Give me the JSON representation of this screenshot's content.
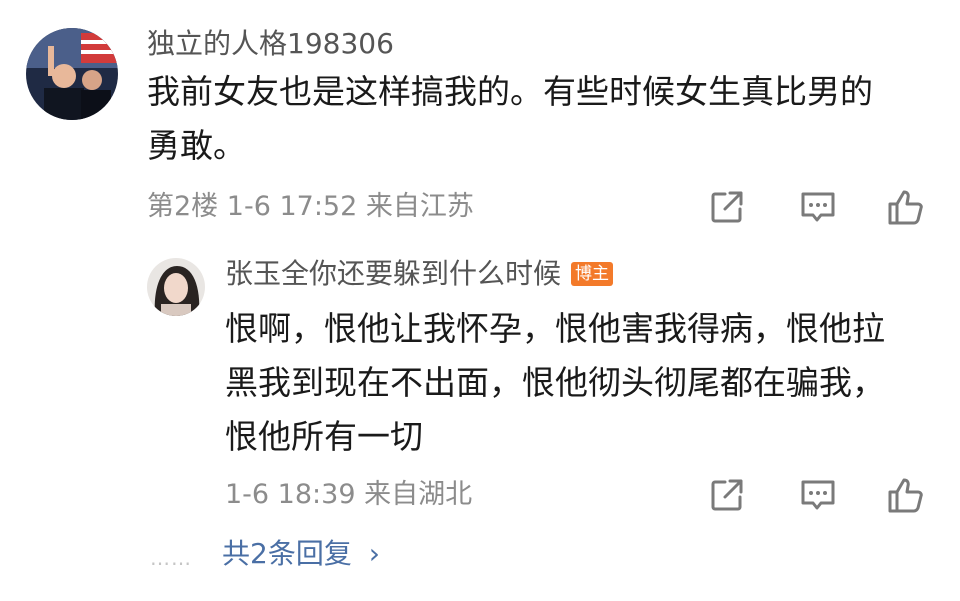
{
  "comment": {
    "username": "独立的人格198306",
    "text_line1": "我前女友也是这样搞我的。有些时候女生真比男的",
    "text_line2": "勇敢。",
    "floor": "第2楼",
    "time": "1-6 17:52",
    "location": "来自江苏"
  },
  "reply": {
    "username": "张玉全你还要躲到什么时候",
    "badge": "博主",
    "text_line1": "恨啊，恨他让我怀孕，恨他害我得病，恨他拉",
    "text_line2": "黑我到现在不出面，恨他彻头彻尾都在骗我，",
    "text_line3": "恨他所有一切",
    "time": "1-6 18:39",
    "location": "来自湖北"
  },
  "replies_link": {
    "dots": "……",
    "label": "共2条回复",
    "chevron": "›"
  },
  "icons": {
    "share": "share-icon",
    "comment": "comment-icon",
    "like": "thumbs-up-icon"
  },
  "colors": {
    "badge": "#f37a2a",
    "link": "#4a6fa5",
    "meta_text": "#8c8c8c"
  }
}
